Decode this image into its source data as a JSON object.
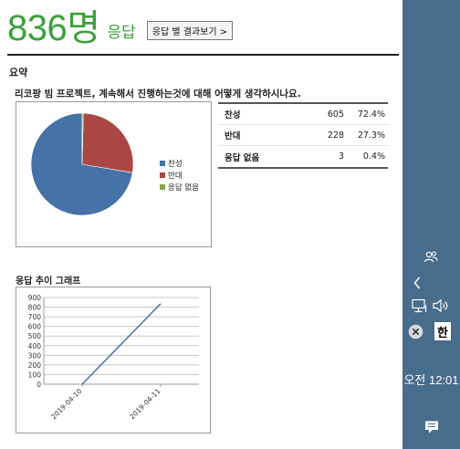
{
  "header": {
    "count": "836명",
    "count_unit": "응답",
    "results_button": "응답 별 결과보기 >"
  },
  "summary": {
    "title": "요약",
    "question": "리코팡 빔 프로젝트, 계속해서 진행하는것에 대해 어떻게 생각하시나요."
  },
  "results": [
    {
      "label": "찬성",
      "count": "605",
      "percent": "72.4%"
    },
    {
      "label": "반대",
      "count": "228",
      "percent": "27.3%"
    },
    {
      "label": "응답 없음",
      "count": "3",
      "percent": "0.4%"
    }
  ],
  "trend": {
    "title": "응답 추이 그래프"
  },
  "chart_data": [
    {
      "type": "pie",
      "categories": [
        "찬성",
        "반대",
        "응답 없음"
      ],
      "values": [
        605,
        228,
        3
      ],
      "colors": [
        "#4572a7",
        "#aa4643",
        "#89a54e"
      ],
      "legend": "right"
    },
    {
      "type": "line",
      "x": [
        "2019-04-10",
        "2019-04-11"
      ],
      "values": [
        0,
        836
      ],
      "ylim": [
        0,
        900
      ],
      "yticks": [
        0,
        100,
        200,
        300,
        400,
        500,
        600,
        700,
        800,
        900
      ],
      "grid": true,
      "color": "#4572a7"
    }
  ],
  "taskbar": {
    "ime_label": "한",
    "clock": "오전 12:01",
    "icons": [
      "people-icon",
      "chevron-left-icon",
      "network-icon",
      "volume-icon",
      "close-circle-icon",
      "notification-icon"
    ]
  }
}
